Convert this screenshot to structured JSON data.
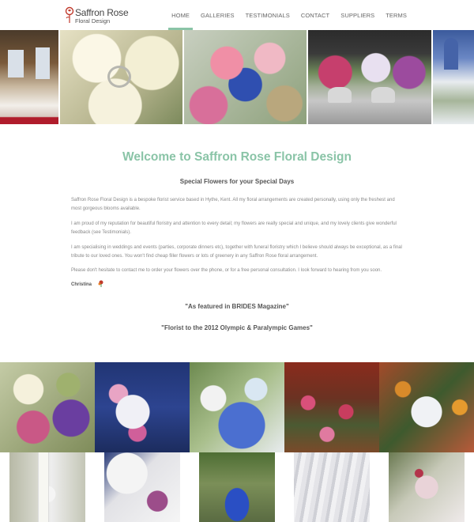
{
  "brand": {
    "title": "Saffron Rose",
    "subtitle": "Floral Design"
  },
  "nav": {
    "items": [
      {
        "label": "HOME",
        "active": true
      },
      {
        "label": "GALLERIES",
        "active": false
      },
      {
        "label": "TESTIMONIALS",
        "active": false
      },
      {
        "label": "CONTACT",
        "active": false
      },
      {
        "label": "SUPPLIERS",
        "active": false
      },
      {
        "label": "TERMS",
        "active": false
      }
    ]
  },
  "main": {
    "title": "Welcome to Saffron Rose Floral Design",
    "subtitle": "Special Flowers for your Special Days",
    "paragraphs": [
      "Saffron Rose Floral Design is a bespoke florist service based in Hythe, Kent. All my floral arrangements are created personally, using only the freshest and most gorgeous blooms available.",
      "I am proud of my reputation for beautiful floristry and attention to every detail; my flowers are really special and unique, and my lovely clients give wonderful feedback (see Testimonials).",
      "I am specialising in weddings and events (parties, corporate dinners etc), together with funeral floristry which I believe should always be exceptional, as a final tribute to our loved ones. You won't find cheap filler flowers or lots of greenery in any Saffron Rose floral arrangement.",
      "Please don't hesitate to contact me to order your flowers over the phone, or for a free personal consultation. I look forward to hearing from you soon."
    ],
    "signature": "Christina",
    "quotes": [
      "\"As featured in BRIDES Magazine\"",
      "\"Florist to the 2012 Olympic & Paralympic Games\""
    ]
  },
  "colors": {
    "accent": "#8ac4a7",
    "brand_rose": "#c0392b"
  }
}
